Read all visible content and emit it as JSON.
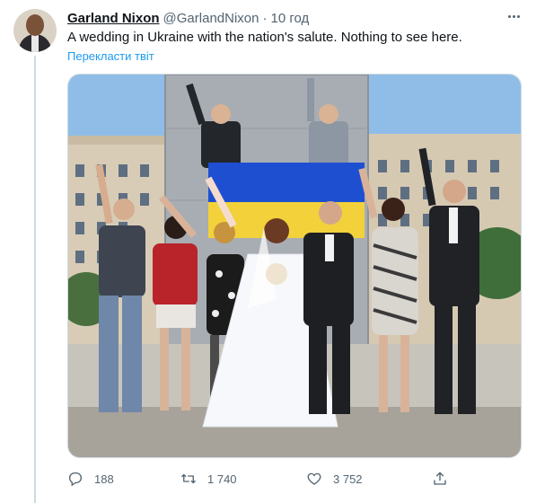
{
  "tweet": {
    "author_name": "Garland Nixon",
    "author_handle": "@GarlandNixon",
    "separator": "·",
    "time": "10 год",
    "text": "A wedding in Ukraine with the nation's salute. Nothing to see here.",
    "translate_label": "Перекласти твіт"
  },
  "actions": {
    "replies": "188",
    "retweets": "1 740",
    "likes": "3 752"
  },
  "icons": {
    "reply": "reply-icon",
    "retweet": "retweet-icon",
    "like": "like-icon",
    "share": "share-icon",
    "more": "more-icon"
  },
  "colors": {
    "text": "#0f1419",
    "secondary": "#536471",
    "link": "#1d9bf0",
    "border": "#cfd9de",
    "flag_blue": "#1f4fd1",
    "flag_yellow": "#f2d13a"
  }
}
